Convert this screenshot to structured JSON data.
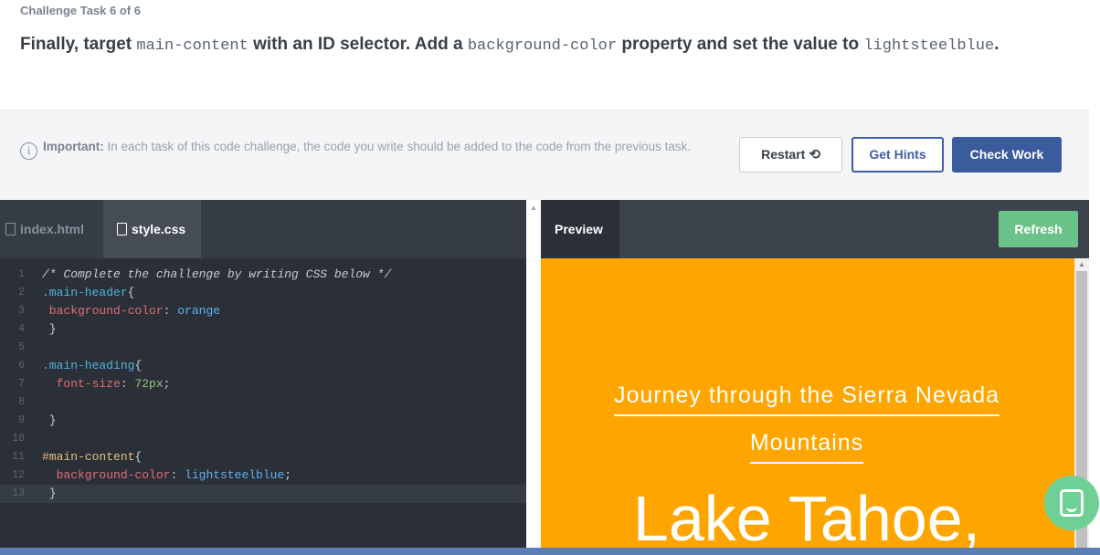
{
  "task": {
    "label": "Challenge Task 6 of 6",
    "text_1": "Finally, target ",
    "code_1": "main-content",
    "text_2": " with an ID selector. Add a ",
    "code_2": "background-color",
    "text_3": " property and set the value to ",
    "code_3": "lightsteelblue",
    "text_4": "."
  },
  "note": {
    "strong": "Important:",
    "text": " In each task of this code challenge, the code you write should be added to the code from the previous task."
  },
  "buttons": {
    "restart": "Restart",
    "hints": "Get Hints",
    "check": "Check Work",
    "refresh": "Refresh"
  },
  "editor": {
    "tabs": [
      "index.html",
      "style.css"
    ],
    "active_tab": "style.css",
    "lines": [
      {
        "n": "1",
        "tokens": [
          {
            "t": "/* Complete the challenge by writing CSS below */",
            "c": "c-comment"
          }
        ]
      },
      {
        "n": "2",
        "tokens": [
          {
            "t": ".main-header",
            "c": "c-sel"
          },
          {
            "t": "{",
            "c": "c-punc"
          }
        ]
      },
      {
        "n": "3",
        "tokens": [
          {
            "t": " background-color",
            "c": "c-prop"
          },
          {
            "t": ": ",
            "c": "c-punc"
          },
          {
            "t": "orange",
            "c": "c-val"
          }
        ]
      },
      {
        "n": "4",
        "tokens": [
          {
            "t": " }",
            "c": "c-punc"
          }
        ]
      },
      {
        "n": "5",
        "tokens": []
      },
      {
        "n": "6",
        "tokens": [
          {
            "t": ".main-heading",
            "c": "c-sel"
          },
          {
            "t": "{",
            "c": "c-punc"
          }
        ]
      },
      {
        "n": "7",
        "tokens": [
          {
            "t": "  font-size",
            "c": "c-prop"
          },
          {
            "t": ": ",
            "c": "c-punc"
          },
          {
            "t": "72px",
            "c": "c-num"
          },
          {
            "t": ";",
            "c": "c-punc"
          }
        ]
      },
      {
        "n": "8",
        "tokens": []
      },
      {
        "n": "9",
        "tokens": [
          {
            "t": " }",
            "c": "c-punc"
          }
        ]
      },
      {
        "n": "10",
        "tokens": []
      },
      {
        "n": "11",
        "tokens": [
          {
            "t": "#main-content",
            "c": "c-id"
          },
          {
            "t": "{",
            "c": "c-punc"
          }
        ]
      },
      {
        "n": "12",
        "tokens": [
          {
            "t": "  background-color",
            "c": "c-prop"
          },
          {
            "t": ": ",
            "c": "c-punc"
          },
          {
            "t": "lightsteelblue",
            "c": "c-val"
          },
          {
            "t": ";",
            "c": "c-punc"
          }
        ]
      },
      {
        "n": "13",
        "tokens": [
          {
            "t": " }",
            "c": "c-punc"
          }
        ],
        "active": true
      }
    ]
  },
  "preview": {
    "tab": "Preview",
    "subheading_1": "Journey through the Sierra Nevada",
    "subheading_2": "Mountains",
    "heading": "Lake Tahoe,"
  },
  "colors": {
    "accent": "#3a5b9c",
    "refresh": "#6bc389",
    "preview_bg": "#ffa500"
  },
  "icons": [
    "info-icon",
    "restart-icon",
    "file-icon",
    "chat-icon"
  ]
}
